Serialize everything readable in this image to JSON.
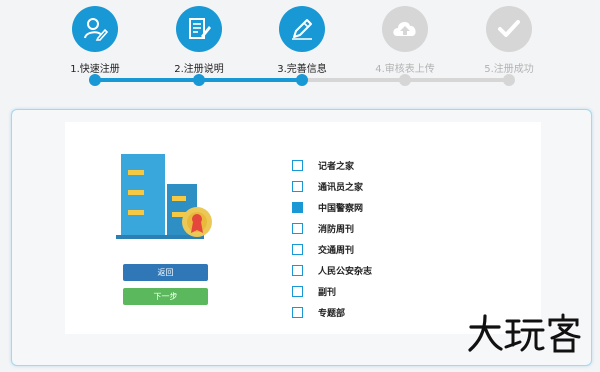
{
  "stepper": {
    "steps": [
      {
        "label": "1.快速注册",
        "icon": "user-edit-icon",
        "state": "done"
      },
      {
        "label": "2.注册说明",
        "icon": "document-edit-icon",
        "state": "done"
      },
      {
        "label": "3.完善信息",
        "icon": "pencil-icon",
        "state": "done"
      },
      {
        "label": "4.审核表上传",
        "icon": "cloud-upload-icon",
        "state": "todo"
      },
      {
        "label": "5.注册成功",
        "icon": "checkmark-icon",
        "state": "todo"
      }
    ],
    "colors": {
      "active": "#1898d5",
      "inactive": "#d6d6d6"
    }
  },
  "buttons": {
    "back": "返回",
    "next": "下一步"
  },
  "options": [
    {
      "label": "记者之家",
      "checked": false
    },
    {
      "label": "通讯员之家",
      "checked": false
    },
    {
      "label": "中国警察网",
      "checked": true
    },
    {
      "label": "消防周刊",
      "checked": false
    },
    {
      "label": "交通周刊",
      "checked": false
    },
    {
      "label": "人民公安杂志",
      "checked": false
    },
    {
      "label": "副刊",
      "checked": false
    },
    {
      "label": "专题部",
      "checked": false
    }
  ],
  "watermark": "大玩客"
}
